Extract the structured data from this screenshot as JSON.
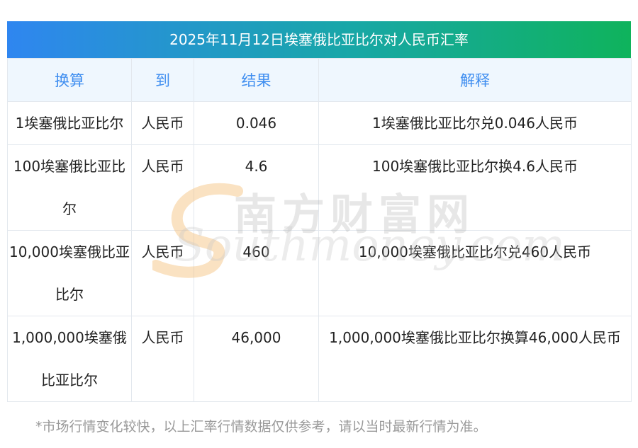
{
  "title": "2025年11月12日埃塞俄比亚比尔对人民币汇率",
  "table": {
    "headers": [
      "换算",
      "到",
      "结果",
      "解释"
    ],
    "rows": [
      {
        "amount": "1埃塞俄比亚比尔",
        "to": "人民币",
        "result": "0.046",
        "explain": "1埃塞俄比亚比尔兑0.046人民币"
      },
      {
        "amount": "100埃塞俄比亚比尔",
        "to": "人民币",
        "result": "4.6",
        "explain": "100埃塞俄比亚比尔换4.6人民币"
      },
      {
        "amount": "10,000埃塞俄比亚比尔",
        "to": "人民币",
        "result": "460",
        "explain": "10,000埃塞俄比亚比尔兑460人民币"
      },
      {
        "amount": "1,000,000埃塞俄比亚比尔",
        "to": "人民币",
        "result": "46,000",
        "explain": "1,000,000埃塞俄比亚比尔换算46,000人民币"
      }
    ]
  },
  "watermark": {
    "cn": "南方财富网",
    "en": "Southmoney.com"
  },
  "footnote": "*市场行情变化较快，以上汇率行情数据仅供参考，请以当时最新行情为准。",
  "colors": {
    "title_gradient_start": "#2f86f0",
    "title_gradient_end": "#0fb35c",
    "header_bg": "#eff7fe",
    "header_text": "#3f8ef0",
    "footnote_text": "#999999"
  }
}
